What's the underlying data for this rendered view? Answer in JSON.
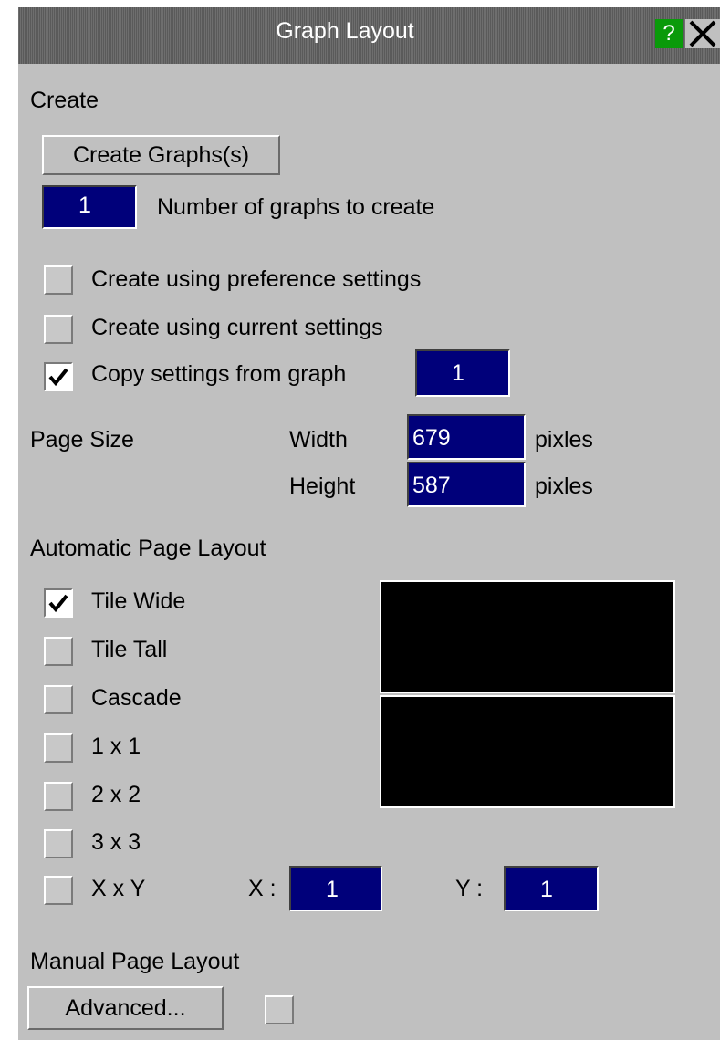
{
  "window": {
    "title": "Graph Layout",
    "help_label": "?",
    "close_icon": "close-icon"
  },
  "create": {
    "section_label": "Create",
    "create_button_label": "Create Graphs(s)",
    "num_graphs_value": "1",
    "num_graphs_label": "Number of graphs to create",
    "options": [
      {
        "label": "Create using preference settings",
        "checked": false
      },
      {
        "label": "Create using current settings",
        "checked": false
      },
      {
        "label": "Copy settings from graph",
        "checked": true
      }
    ],
    "copy_from_graph_value": "1"
  },
  "page_size": {
    "label": "Page Size",
    "width_label": "Width",
    "width_value": "679",
    "width_unit": "pixles",
    "height_label": "Height",
    "height_value": "587",
    "height_unit": "pixles"
  },
  "auto_layout": {
    "section_label": "Automatic Page Layout",
    "options": [
      {
        "label": "Tile Wide",
        "checked": true
      },
      {
        "label": "Tile Tall",
        "checked": false
      },
      {
        "label": "Cascade",
        "checked": false
      },
      {
        "label": "1 x 1",
        "checked": false
      },
      {
        "label": "2 x 2",
        "checked": false
      },
      {
        "label": "3 x 3",
        "checked": false
      },
      {
        "label": "X x Y",
        "checked": false
      }
    ],
    "x_label": "X :",
    "x_value": "1",
    "y_label": "Y :",
    "y_value": "1"
  },
  "manual_layout": {
    "section_label": "Manual Page Layout",
    "advanced_button_label": "Advanced...",
    "checked": false
  },
  "colors": {
    "panel_bg": "#c0c0c0",
    "field_bg": "#00007a",
    "help_bg": "#0a9a0a",
    "preview_bg": "#000000"
  }
}
